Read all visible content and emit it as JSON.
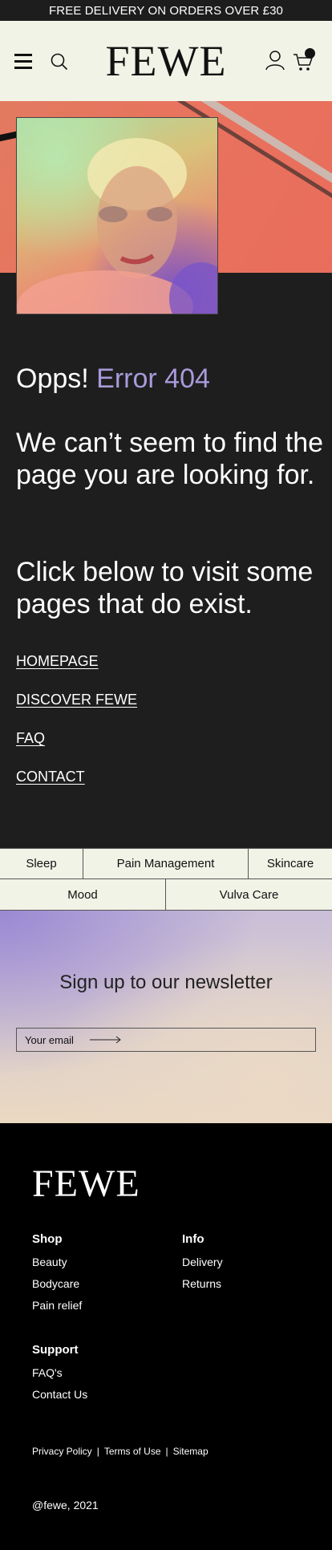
{
  "announcement": "FREE DELIVERY ON ORDERS OVER £30",
  "header": {
    "logo": "FEWE"
  },
  "error": {
    "lead": "Opps!",
    "code": "Error 404",
    "message1": "We can’t seem to find the page you are looking for.",
    "message2": "Click below to visit some pages that do exist."
  },
  "links": [
    {
      "label": "HOMEPAGE"
    },
    {
      "label": "DISCOVER FEWE"
    },
    {
      "label": "FAQ "
    },
    {
      "label": "CONTACT"
    }
  ],
  "categories": {
    "row1": [
      "Sleep",
      "Pain Management",
      "Skincare"
    ],
    "row2": [
      "Mood",
      "Vulva Care"
    ]
  },
  "newsletter": {
    "title": "Sign up to our newsletter",
    "placeholder": "Your email"
  },
  "footer": {
    "logo": "FEWE",
    "shop": {
      "heading": "Shop",
      "items": [
        "Beauty",
        "Bodycare",
        "Pain relief"
      ]
    },
    "info": {
      "heading": "Info",
      "items": [
        "Delivery",
        "Returns"
      ]
    },
    "support": {
      "heading": "Support",
      "items": [
        "FAQ's",
        "Contact Us"
      ]
    },
    "legal": [
      "Privacy Policy",
      "Terms of Use",
      "Sitemap"
    ],
    "separator": "|",
    "copyright": "@fewe, 2021"
  },
  "colors": {
    "accent": "#a99bdb",
    "cream": "#f2f3e7",
    "dark": "#1e1e1e"
  }
}
